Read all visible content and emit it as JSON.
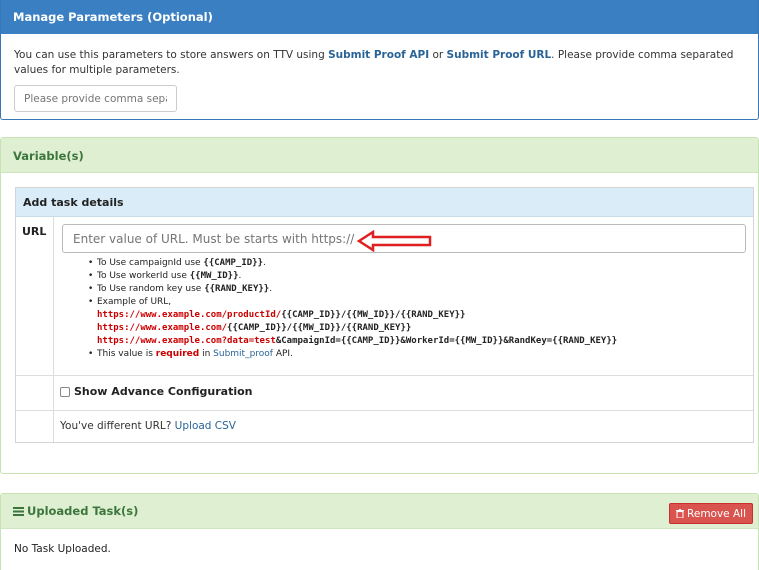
{
  "manage": {
    "title": "Manage Parameters (Optional)",
    "desc_pre": "You can use this parameters to store answers on TTV using ",
    "link1": "Submit Proof API",
    "desc_mid": " or ",
    "link2": "Submit Proof URL",
    "desc_post": ". Please provide comma separated values for multiple parameters.",
    "input_placeholder": "Please provide comma separated values"
  },
  "variables": {
    "title": "Variable(s)",
    "table_title": "Add task details",
    "url_label": "URL",
    "url_placeholder": "Enter value of URL. Must be starts with https://",
    "hints": {
      "h1_text": "To Use campaignId use ",
      "h1_code": "{{CAMP_ID}}",
      "h2_text": "To Use workerId use ",
      "h2_code": "{{MW_ID}}",
      "h3_text": "To Use random key use ",
      "h3_code": "{{RAND_KEY}}",
      "h4_text": "Example of URL,",
      "ex1_red": "https://www.example.com/productId/",
      "ex1_code": "{{CAMP_ID}}/{{MW_ID}}/{{RAND_KEY}}",
      "ex2_red": "https://www.example.com/",
      "ex2_code": "{{CAMP_ID}}/{{MW_ID}}/{{RAND_KEY}}",
      "ex3_red": "https://www.example.com?data=test",
      "ex3_code": "&CampaignId={{CAMP_ID}}&WorkerId={{MW_ID}}&RandKey={{RAND_KEY}}",
      "h5_pre": "This value is ",
      "h5_req": "required",
      "h5_mid": " in ",
      "h5_link": "Submit_proof",
      "h5_post": " API."
    },
    "advance_label": "Show Advance Configuration",
    "csv_text": "You've different URL? ",
    "csv_link": "Upload CSV"
  },
  "uploaded": {
    "title": "Uploaded Task(s)",
    "remove_label": "Remove All",
    "empty_text": "No Task Uploaded."
  },
  "colors": {
    "primary": "#3a7fc1",
    "success_bg": "#deefd2",
    "danger": "#d9534f",
    "arrow": "#e02020"
  }
}
